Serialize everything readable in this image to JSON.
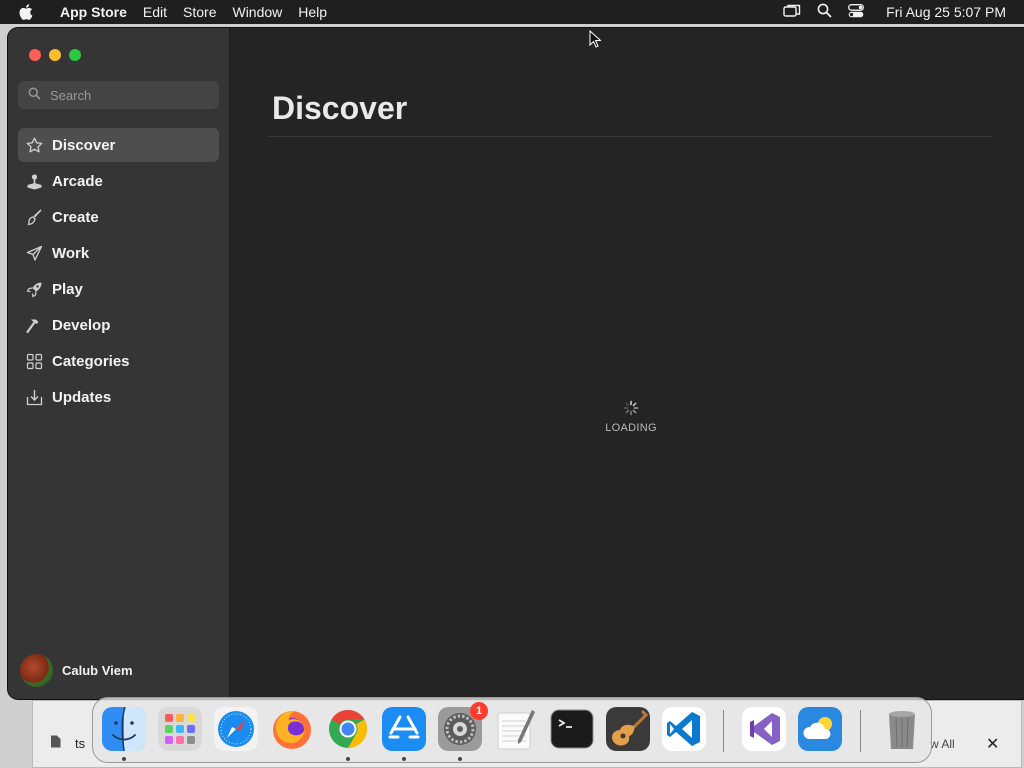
{
  "menubar": {
    "app_name": "App Store",
    "menus": [
      "Edit",
      "Store",
      "Window",
      "Help"
    ],
    "clock": "Fri Aug 25  5:07 PM"
  },
  "sidebar": {
    "search_placeholder": "Search",
    "items": [
      {
        "label": "Discover",
        "icon": "star-icon",
        "active": true
      },
      {
        "label": "Arcade",
        "icon": "joystick-icon",
        "active": false
      },
      {
        "label": "Create",
        "icon": "paintbrush-icon",
        "active": false
      },
      {
        "label": "Work",
        "icon": "paper-plane-icon",
        "active": false
      },
      {
        "label": "Play",
        "icon": "rocket-icon",
        "active": false
      },
      {
        "label": "Develop",
        "icon": "hammer-icon",
        "active": false
      },
      {
        "label": "Categories",
        "icon": "grid-icon",
        "active": false
      },
      {
        "label": "Updates",
        "icon": "download-tray-icon",
        "active": false
      }
    ],
    "user_name": "Calub Viem"
  },
  "main": {
    "title": "Discover",
    "loading_text": "LOADING"
  },
  "background_window": {
    "left_text": "ts",
    "right_text": "w All"
  },
  "dock": {
    "apps": [
      {
        "name": "Finder",
        "running": true
      },
      {
        "name": "Launchpad",
        "running": false
      },
      {
        "name": "Safari",
        "running": false
      },
      {
        "name": "Firefox",
        "running": false
      },
      {
        "name": "Google Chrome",
        "running": true
      },
      {
        "name": "App Store",
        "running": true
      },
      {
        "name": "System Settings",
        "running": true,
        "badge": "1"
      },
      {
        "name": "TextEdit",
        "running": false
      },
      {
        "name": "Terminal",
        "running": false
      },
      {
        "name": "GarageBand",
        "running": false
      },
      {
        "name": "Visual Studio Code",
        "running": false
      },
      {
        "name": "Visual Studio",
        "running": false
      },
      {
        "name": "Weather",
        "running": false
      },
      {
        "name": "Trash",
        "running": false
      }
    ]
  },
  "colors": {
    "window_bg": "#242424",
    "sidebar_bg": "#353535",
    "active_item_bg": "#4e4e4e",
    "traffic_close": "#fe5f57",
    "traffic_min": "#febc2e",
    "traffic_max": "#28c840",
    "badge": "#ff3b30"
  }
}
